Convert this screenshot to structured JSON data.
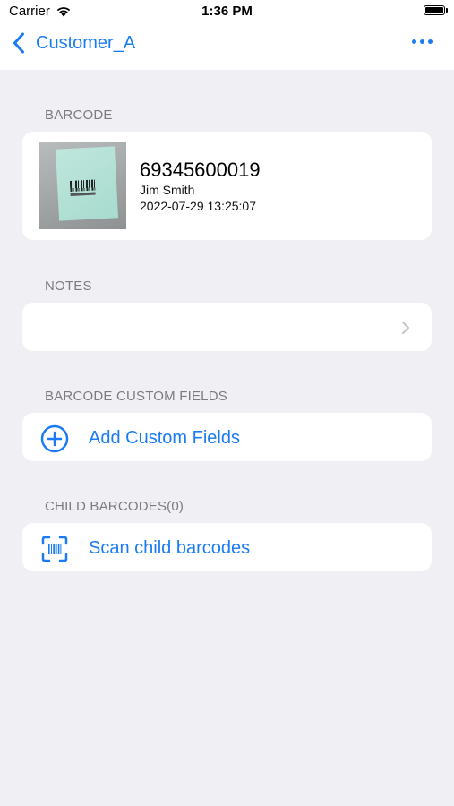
{
  "status_bar": {
    "carrier": "Carrier",
    "time": "1:36 PM"
  },
  "nav": {
    "back_label": "Customer_A",
    "more_icon": "ellipsis-icon"
  },
  "sections": {
    "barcode": {
      "header": "BARCODE",
      "value": "69345600019",
      "user": "Jim Smith",
      "timestamp": "2022-07-29 13:25:07"
    },
    "notes": {
      "header": "NOTES",
      "value": ""
    },
    "custom_fields": {
      "header": "BARCODE CUSTOM FIELDS",
      "action_label": "Add Custom Fields",
      "icon": "plus-circle-icon"
    },
    "child_barcodes": {
      "header": "CHILD BARCODES(0)",
      "action_label": "Scan child barcodes",
      "icon": "barcode-scan-icon"
    }
  },
  "colors": {
    "accent": "#1a7cf5",
    "background": "#efeff4",
    "card": "#ffffff",
    "section_header": "#7b7b80"
  }
}
